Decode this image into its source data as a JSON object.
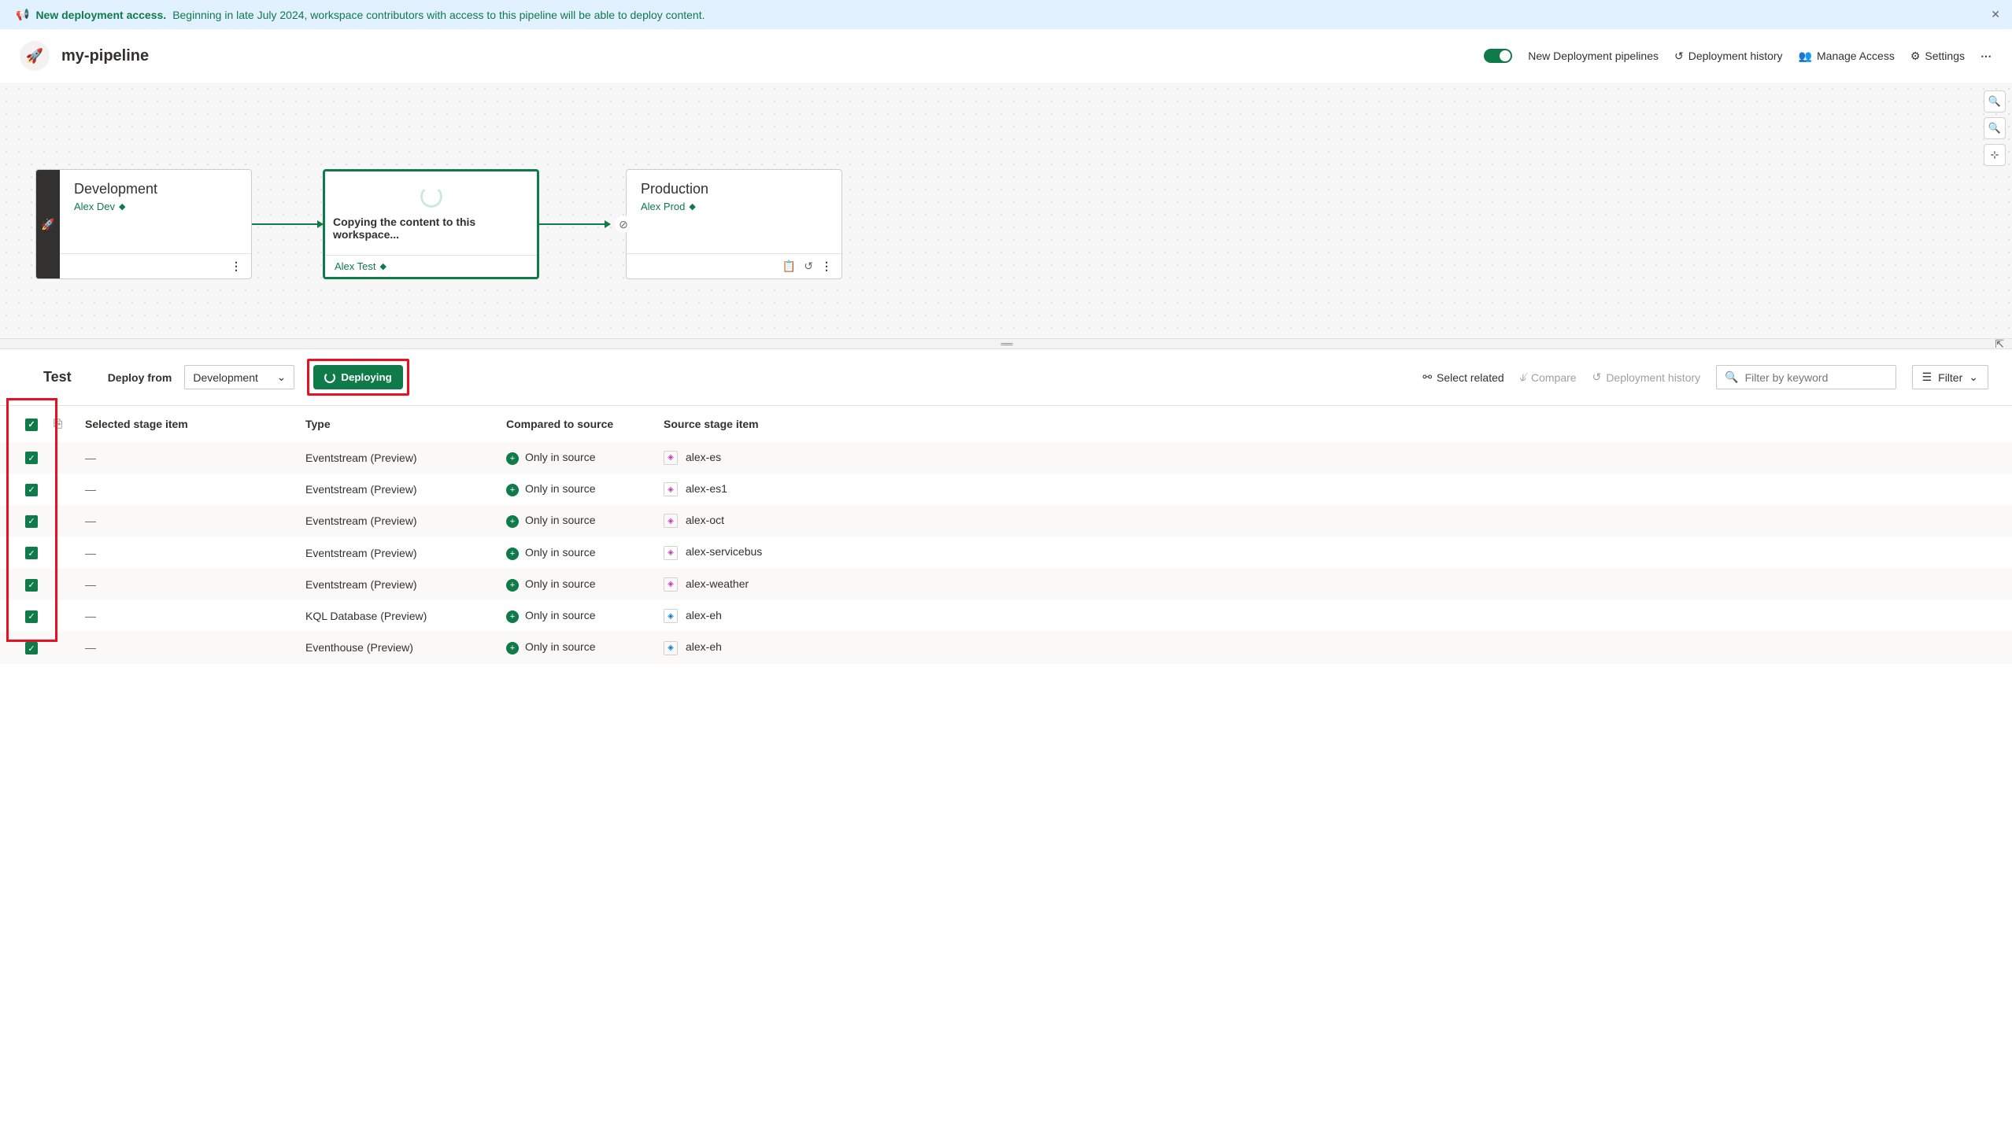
{
  "banner": {
    "title": "New deployment access.",
    "text": "Beginning in late July 2024, workspace contributors with access to this pipeline will be able to deploy content."
  },
  "header": {
    "title": "my-pipeline",
    "toggle_label": "New Deployment pipelines",
    "history": "Deployment history",
    "access": "Manage Access",
    "settings": "Settings"
  },
  "stages": {
    "dev": {
      "title": "Development",
      "subtitle": "Alex Dev"
    },
    "test": {
      "loading_text": "Copying the content to this workspace...",
      "subtitle": "Alex Test"
    },
    "prod": {
      "title": "Production",
      "subtitle": "Alex Prod"
    }
  },
  "toolbar": {
    "title": "Test",
    "deploy_from_label": "Deploy from",
    "dropdown_value": "Development",
    "deploy_btn": "Deploying",
    "select_related": "Select related",
    "compare": "Compare",
    "history": "Deployment history",
    "search_placeholder": "Filter by keyword",
    "filter": "Filter"
  },
  "table": {
    "headers": {
      "selected": "Selected stage item",
      "type": "Type",
      "compared": "Compared to source",
      "source": "Source stage item"
    },
    "compared_label": "Only in source",
    "rows": [
      {
        "selected": "—",
        "type": "Eventstream (Preview)",
        "source": "alex-es",
        "icon": "pink"
      },
      {
        "selected": "—",
        "type": "Eventstream (Preview)",
        "source": "alex-es1",
        "icon": "pink"
      },
      {
        "selected": "—",
        "type": "Eventstream (Preview)",
        "source": "alex-oct",
        "icon": "pink"
      },
      {
        "selected": "—",
        "type": "Eventstream (Preview)",
        "source": "alex-servicebus",
        "icon": "pink"
      },
      {
        "selected": "—",
        "type": "Eventstream (Preview)",
        "source": "alex-weather",
        "icon": "pink"
      },
      {
        "selected": "—",
        "type": "KQL Database (Preview)",
        "source": "alex-eh",
        "icon": "blue"
      },
      {
        "selected": "—",
        "type": "Eventhouse (Preview)",
        "source": "alex-eh",
        "icon": "blue"
      }
    ]
  }
}
